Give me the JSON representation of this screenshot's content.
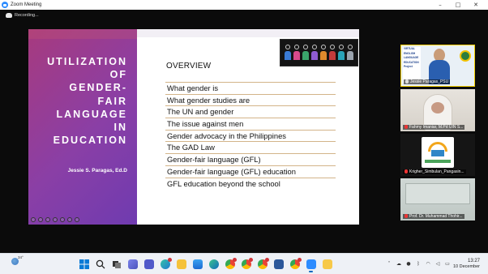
{
  "window": {
    "title": "Zoom Meeting",
    "controls": [
      "–",
      "□",
      "✕"
    ]
  },
  "recording": {
    "label": "Recording..."
  },
  "slide": {
    "title_lines": [
      "UTILIZATION",
      "OF",
      "GENDER-",
      "FAIR",
      "LANGUAGE",
      "IN",
      "EDUCATION"
    ],
    "author": "Jessie S. Paragas, Ed.D",
    "heading": "OVERVIEW",
    "topics": [
      "What gender is",
      "What gender studies are",
      "The UN and gender",
      "The issue against men",
      "Gender advocacy in the Philippines",
      "The GAD Law",
      "Gender-fair language (GFL)",
      "Gender-fair language (GFL) education",
      "GFL education beyond the school"
    ]
  },
  "participants": [
    {
      "name": "Jessie Paragas_PSU",
      "muted": false,
      "active": true,
      "banner": [
        "VIRTUAL",
        "ENGLISH",
        "LANGUAGE",
        "EDUCATION",
        "Project"
      ]
    },
    {
      "name": "Fahmy Imaniar, M.Pd UIN S...",
      "muted": true,
      "active": false
    },
    {
      "name": "Krigher_Simbulan_Pangasin...",
      "muted": true,
      "active": false
    },
    {
      "name": "Prof. Dr. Muhammad Thohir...",
      "muted": true,
      "active": false
    }
  ],
  "taskbar": {
    "weather_temp": "34°",
    "time": "13:27",
    "date": "10 December",
    "colors": {
      "accent": "#0067c0",
      "badge": "#d13438"
    }
  }
}
